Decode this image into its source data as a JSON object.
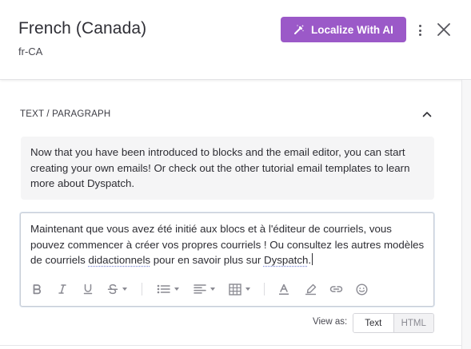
{
  "header": {
    "title": "French (Canada)",
    "locale_code": "fr-CA",
    "localize_button_label": "Localize With AI",
    "localize_button_icon": "magic-wand-icon",
    "accent_color": "#9b59c8"
  },
  "section": {
    "label": "TEXT / PARAGRAPH",
    "collapse_icon": "chevron-up-icon"
  },
  "source": {
    "text": "Now that you have been introduced to blocks and the email editor, you can start creating your own emails! Or check out the other tutorial email templates to learn more about Dyspatch."
  },
  "editor": {
    "text_before": "Maintenant que vous avez été initié aux blocs et à l'éditeur de courriels, vous pouvez commencer à créer vos propres courriels ! Ou consultez les autres modèles de courriels ",
    "spell_word_1": "didactionnels",
    "text_middle": " pour en savoir plus sur ",
    "spell_word_2": "Dyspatch",
    "text_end": ".",
    "toolbar": [
      "bold-icon",
      "italic-icon",
      "underline-icon",
      "strikethrough-icon",
      "bulleted-list-icon",
      "align-left-icon",
      "table-icon",
      "text-color-icon",
      "highlight-icon",
      "link-icon",
      "emoji-icon"
    ]
  },
  "view_as": {
    "label": "View as:",
    "options": [
      "Text",
      "HTML"
    ],
    "selected": "Text"
  }
}
